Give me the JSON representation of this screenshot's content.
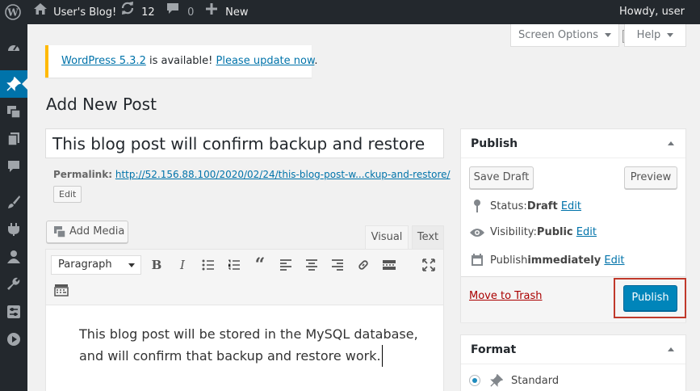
{
  "adminbar": {
    "site_name": "User's Blog!",
    "updates_count": "12",
    "comments_count": "0",
    "new_label": "New",
    "howdy": "Howdy, user"
  },
  "screen_meta": {
    "screen_options": "Screen Options",
    "help": "Help"
  },
  "notice": {
    "version_link": "WordPress 5.3.2",
    "middle": " is available! ",
    "update_link": "Please update now",
    "end": "."
  },
  "page_title": "Add New Post",
  "post": {
    "title": "This blog post will confirm backup and restore",
    "permalink_label": "Permalink:",
    "permalink_url": "http://52.156.88.100/2020/02/24/this-blog-post-w...ckup-and-restore/",
    "edit_label": "Edit",
    "content_line1": "This blog post will be stored in the MySQL database,",
    "content_line2": "and will confirm that backup and restore work."
  },
  "editor": {
    "add_media": "Add Media",
    "tab_visual": "Visual",
    "tab_text": "Text",
    "format_select": "Paragraph"
  },
  "publish_box": {
    "title": "Publish",
    "save_draft": "Save Draft",
    "preview": "Preview",
    "status_label": "Status: ",
    "status_value": "Draft",
    "visibility_label": "Visibility: ",
    "visibility_value": "Public",
    "publish_label": "Publish ",
    "publish_value": "immediately",
    "edit": "Edit",
    "trash": "Move to Trash",
    "publish_button": "Publish"
  },
  "format_box": {
    "title": "Format",
    "option_standard": "Standard"
  },
  "colors": {
    "adminbar_bg": "#23282d",
    "accent": "#0073aa",
    "publish_button": "#0085ba",
    "highlight_border": "#c0392b",
    "notice_border": "#ffb900"
  }
}
